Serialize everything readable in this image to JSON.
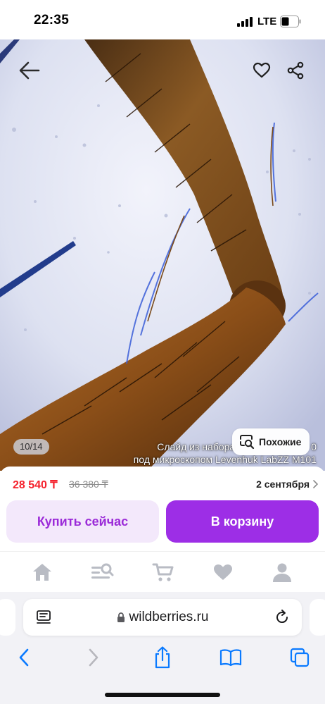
{
  "status_bar": {
    "time": "22:35",
    "network": "LTE"
  },
  "gallery": {
    "counter": "10/14",
    "caption_line1": "Слайд из набора",
    "caption_line1_suffix": "0",
    "caption_line2": "под микроскопом Levenhuk LabZZ M101",
    "similar_label": "Похожие"
  },
  "product": {
    "price": "28 540 ₸",
    "old_price": "36 380 ₸",
    "delivery_date": "2 сентября",
    "buy_now_label": "Купить сейчас",
    "add_to_cart_label": "В корзину"
  },
  "bottom_nav": {
    "items": [
      "home-icon",
      "catalog-search-icon",
      "cart-icon",
      "favorites-icon",
      "profile-icon"
    ]
  },
  "browser": {
    "url": "wildberries.ru"
  },
  "colors": {
    "accent": "#9d2ee6",
    "price": "#f5222d",
    "ios_blue": "#0a7aff"
  }
}
